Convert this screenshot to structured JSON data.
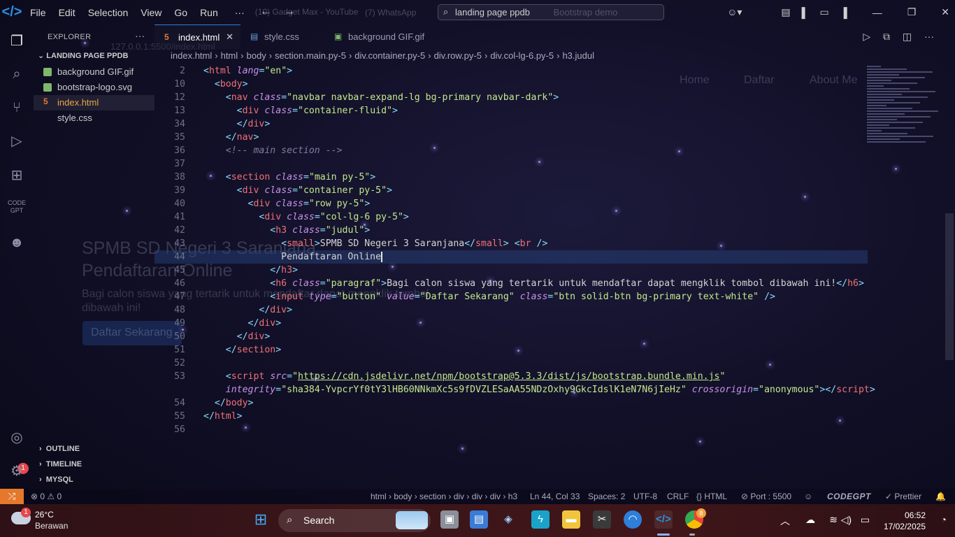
{
  "title_bar": {
    "menu": [
      "File",
      "Edit",
      "Selection",
      "View",
      "Go",
      "Run"
    ],
    "more_label": "···",
    "ghost_tabs": [
      "(10) Gadget Max - YouTube",
      "(7) WhatsApp",
      "Bootstrap demo"
    ],
    "command_center": "landing page ppdb"
  },
  "sidebar": {
    "title": "EXPLORER",
    "more": "···",
    "folder": "LANDING PAGE PPDB",
    "files": [
      "background GIF.gif",
      "bootstrap-logo.svg",
      "index.html",
      "style.css"
    ],
    "selected_file": "index.html",
    "sections": [
      "OUTLINE",
      "TIMELINE",
      "MYSQL"
    ]
  },
  "activity_badge": "1",
  "tabs": [
    {
      "label": "index.html",
      "icon": "html-icon",
      "active": true
    },
    {
      "label": "style.css",
      "icon": "css-icon",
      "active": false
    },
    {
      "label": "background GIF.gif",
      "icon": "image-icon",
      "active": false
    }
  ],
  "breadcrumb": [
    "index.html",
    "html",
    "body",
    "section.main.py-5",
    "div.container.py-5",
    "div.row.py-5",
    "div.col-lg-6.py-5",
    "h3.judul"
  ],
  "ghost_page": {
    "url": "127.0.0.1:5500/index.html",
    "nav": [
      "Home",
      "Daftar",
      "About Me"
    ],
    "heading_line1": "SPMB SD Negeri 3 Saranjana",
    "heading_line2": "Pendaftaran Online",
    "paragraph_line1": "Bagi calon siswa yang tertarik untuk mendaftar dapat mengklik tombol",
    "paragraph_line2": "dibawah ini!",
    "button": "Daftar Sekarang"
  },
  "code_lines": [
    {
      "n": "2",
      "html": "<span class='punc'>&lt;</span><span class='tag'>html</span> <span class='attr'>lang</span><span class='punc'>=</span><span class='str'>\"en\"</span><span class='punc'>&gt;</span>"
    },
    {
      "n": "10",
      "html": "  <span class='punc'>&lt;</span><span class='tag'>body</span><span class='punc'>&gt;</span>"
    },
    {
      "n": "12",
      "html": "    <span class='punc'>&lt;</span><span class='tag'>nav</span> <span class='attr'>class</span><span class='punc'>=</span><span class='str'>\"navbar navbar-expand-lg bg-primary navbar-dark\"</span><span class='punc'>&gt;</span>"
    },
    {
      "n": "13",
      "html": "      <span class='punc'>&lt;</span><span class='tag'>div</span> <span class='attr'>class</span><span class='punc'>=</span><span class='str'>\"container-fluid\"</span><span class='punc'>&gt;</span>"
    },
    {
      "n": "34",
      "html": "      <span class='punc'>&lt;/</span><span class='tag'>div</span><span class='punc'>&gt;</span>"
    },
    {
      "n": "35",
      "html": "    <span class='punc'>&lt;/</span><span class='tag'>nav</span><span class='punc'>&gt;</span>"
    },
    {
      "n": "36",
      "html": "    <span class='cmt'>&lt;!-- main section --&gt;</span>"
    },
    {
      "n": "37",
      "html": ""
    },
    {
      "n": "38",
      "html": "    <span class='punc'>&lt;</span><span class='tag'>section</span> <span class='attr'>class</span><span class='punc'>=</span><span class='str'>\"main py-5\"</span><span class='punc'>&gt;</span>"
    },
    {
      "n": "39",
      "html": "      <span class='punc'>&lt;</span><span class='tag'>div</span> <span class='attr'>class</span><span class='punc'>=</span><span class='str'>\"container py-5\"</span><span class='punc'>&gt;</span>"
    },
    {
      "n": "40",
      "html": "        <span class='punc'>&lt;</span><span class='tag'>div</span> <span class='attr'>class</span><span class='punc'>=</span><span class='str'>\"row py-5\"</span><span class='punc'>&gt;</span>"
    },
    {
      "n": "41",
      "html": "          <span class='punc'>&lt;</span><span class='tag'>div</span> <span class='attr'>class</span><span class='punc'>=</span><span class='str'>\"col-lg-6 py-5\"</span><span class='punc'>&gt;</span>"
    },
    {
      "n": "42",
      "html": "            <span class='punc'>&lt;</span><span class='tag'>h3</span> <span class='attr'>class</span><span class='punc'>=</span><span class='str'>\"judul\"</span><span class='punc'>&gt;</span>"
    },
    {
      "n": "43",
      "html": "              <span class='punc'>&lt;</span><span class='tag'>small</span><span class='punc'>&gt;</span>SPMB SD Negeri 3 Saranjana<span class='punc'>&lt;/</span><span class='tag'>small</span><span class='punc'>&gt;</span> <span class='punc'>&lt;</span><span class='tag'>br</span> <span class='punc'>/&gt;</span>"
    },
    {
      "n": "44",
      "html": "              Pendaftaran Online<span class='cursor'></span>"
    },
    {
      "n": "45",
      "html": "            <span class='punc'>&lt;/</span><span class='tag'>h3</span><span class='punc'>&gt;</span>"
    },
    {
      "n": "46",
      "html": "            <span class='punc'>&lt;</span><span class='tag'>h6</span> <span class='attr'>class</span><span class='punc'>=</span><span class='str'>\"paragraf\"</span><span class='punc'>&gt;</span>Bagi calon siswa yang tertarik untuk mendaftar dapat mengklik tombol dibawah ini!<span class='punc'>&lt;/</span><span class='tag'>h6</span><span class='punc'>&gt;</span>"
    },
    {
      "n": "47",
      "html": "            <span class='punc'>&lt;</span><span class='tag'>input</span> <span class='attr'>type</span><span class='punc'>=</span><span class='str'>\"button\"</span> <span class='attr'>value</span><span class='punc'>=</span><span class='str'>\"Daftar Sekarang\"</span> <span class='attr'>class</span><span class='punc'>=</span><span class='str'>\"btn solid-btn bg-primary text-white\"</span> <span class='punc'>/&gt;</span>"
    },
    {
      "n": "48",
      "html": "          <span class='punc'>&lt;/</span><span class='tag'>div</span><span class='punc'>&gt;</span>"
    },
    {
      "n": "49",
      "html": "        <span class='punc'>&lt;/</span><span class='tag'>div</span><span class='punc'>&gt;</span>"
    },
    {
      "n": "50",
      "html": "      <span class='punc'>&lt;/</span><span class='tag'>div</span><span class='punc'>&gt;</span>"
    },
    {
      "n": "51",
      "html": "    <span class='punc'>&lt;/</span><span class='tag'>section</span><span class='punc'>&gt;</span>"
    },
    {
      "n": "52",
      "html": ""
    },
    {
      "n": "53",
      "html": "    <span class='punc'>&lt;</span><span class='tag'>script</span> <span class='attr'>src</span><span class='punc'>=</span><span class='str'>\"</span><span class='link'>https://cdn.jsdelivr.net/npm/bootstrap@5.3.3/dist/js/bootstrap.bundle.min.js</span><span class='str'>\"</span>"
    },
    {
      "n": "",
      "html": "    <span class='attr'>integrity</span><span class='punc'>=</span><span class='str'>\"sha384-YvpcrYf0tY3lHB60NNkmXc5s9fDVZLESaAA55NDzOxhy9GkcIdslK1eN7N6jIeHz\"</span> <span class='attr'>crossorigin</span><span class='punc'>=</span><span class='str'>\"anonymous\"</span><span class='punc'>&gt;&lt;/</span><span class='tag'>script</span><span class='punc'>&gt;</span>"
    },
    {
      "n": "54",
      "html": "  <span class='punc'>&lt;/</span><span class='tag'>body</span><span class='punc'>&gt;</span>"
    },
    {
      "n": "55",
      "html": "<span class='punc'>&lt;/</span><span class='tag'>html</span><span class='punc'>&gt;</span>"
    },
    {
      "n": "56",
      "html": ""
    }
  ],
  "status_bar": {
    "problems": "⊗ 0 ⚠ 0",
    "path": "html › body › section › div › div › div › h3",
    "position": "Ln 44, Col 33",
    "spaces": "Spaces: 2",
    "encoding": "UTF-8",
    "eol": "CRLF",
    "language": "{} HTML",
    "port": "⊘ Port : 5500",
    "codegpt": "CODEGPT",
    "prettier": "✓ Prettier"
  },
  "taskbar": {
    "temperature": "26°C",
    "weather": "Berawan",
    "weather_badge": "1",
    "search": "Search",
    "chrome_badge": "8",
    "time": "06:52",
    "date": "17/02/2025"
  }
}
